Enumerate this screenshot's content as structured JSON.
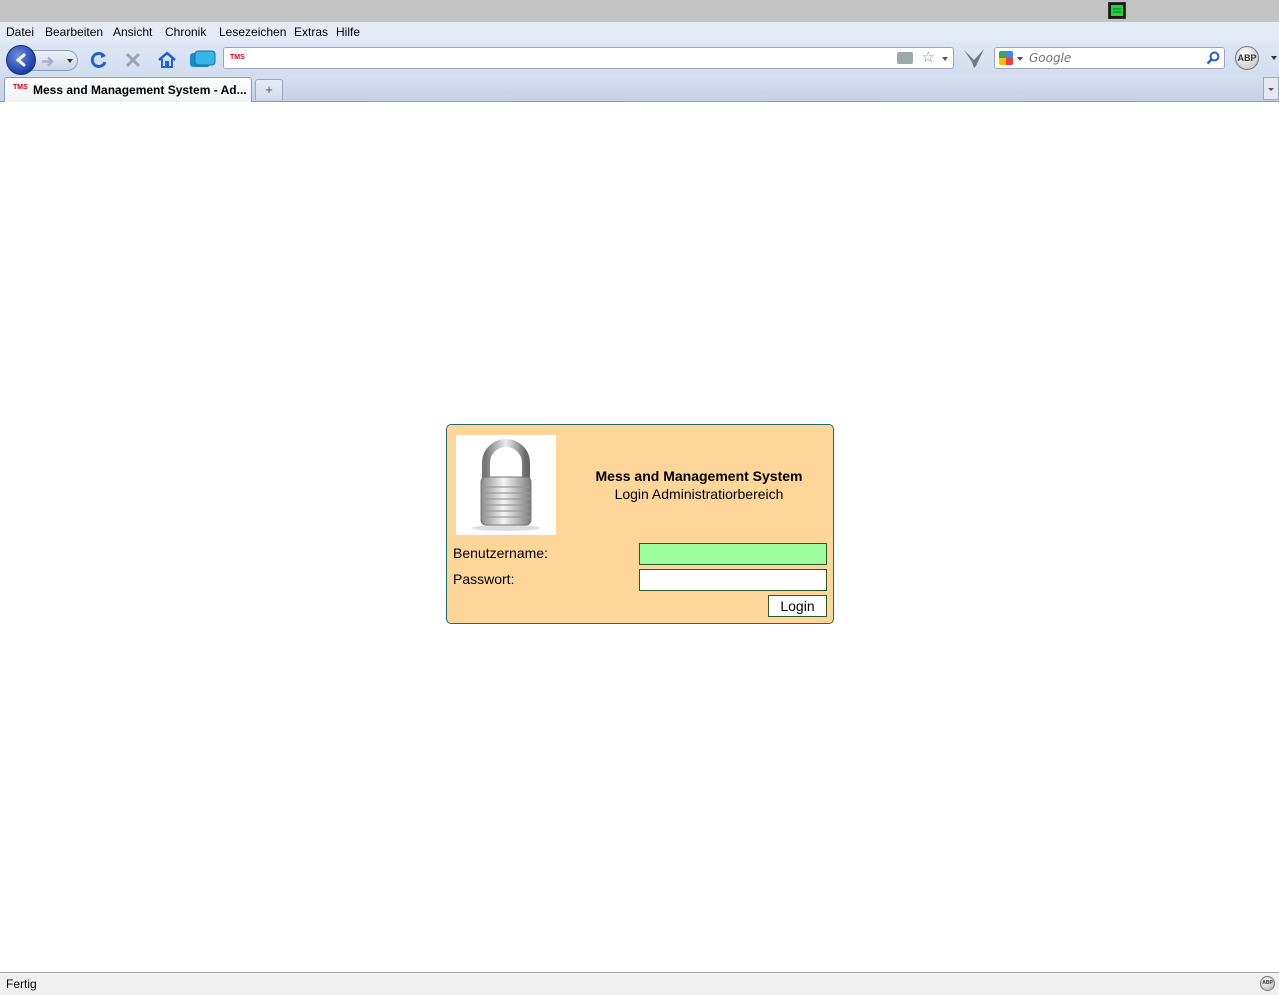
{
  "menu": [
    "Datei",
    "Bearbeiten",
    "Ansicht",
    "Chronik",
    "Lesezeichen",
    "Extras",
    "Hilfe"
  ],
  "url_favicon": "TMS",
  "search": {
    "placeholder": "Google"
  },
  "abp_label": "ABP",
  "tab": {
    "favicon": "TMS",
    "title": "Mess and Management System - Ad..."
  },
  "new_tab_label": "+",
  "login": {
    "title": "Mess and Management System",
    "subtitle": "Login Administratiorbereich",
    "username_label": "Benutzername:",
    "password_label": "Passwort:",
    "username_value": "",
    "password_value": "",
    "button_label": "Login"
  },
  "status": {
    "text": "Fertig"
  },
  "icons": {
    "back": "back-arrow-icon",
    "forward": "forward-arrow-icon",
    "reload": "reload-icon",
    "stop": "stop-icon",
    "home": "home-icon",
    "tabs": "tab-candy-icon",
    "bookmark": "star-icon",
    "rss": "rss-icon",
    "bird": "bird-addon-icon",
    "search": "magnifier-icon",
    "lock": "padlock-icon",
    "tray": "tray-icon"
  },
  "colors": {
    "login_bg": "#fed699",
    "login_border": "#1e6b6b",
    "username_field": "#9bfd9b"
  }
}
